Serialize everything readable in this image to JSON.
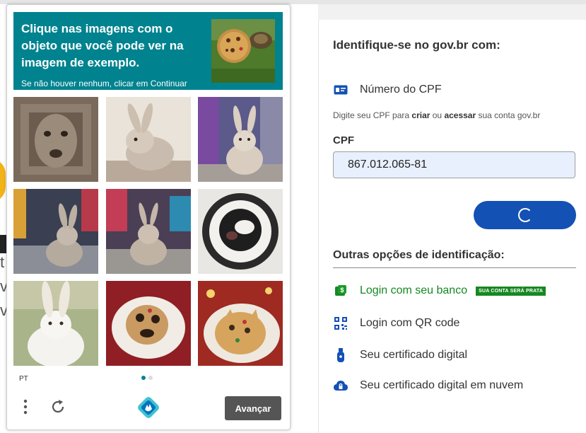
{
  "captcha": {
    "prompt": "Clique nas imagens com o objeto que você pode ver na imagem de exemplo.",
    "prompt_sub": "Se não houver nenhum, clicar em Continuar",
    "example_image": "cookie-and-turtle-image",
    "tiles": [
      {
        "subject": "distorted-animal-face"
      },
      {
        "subject": "rabbit"
      },
      {
        "subject": "rabbit"
      },
      {
        "subject": "rabbit-city-street"
      },
      {
        "subject": "rabbit-city-street"
      },
      {
        "subject": "distorted-plate"
      },
      {
        "subject": "white-rabbit"
      },
      {
        "subject": "cookie-on-plate"
      },
      {
        "subject": "cookie-on-plate"
      }
    ],
    "language": "PT",
    "page_dots": 2,
    "active_dot": 0,
    "submit_label": "Avançar",
    "accent_color": "#00838f"
  },
  "gov": {
    "title": "Identifique-se no gov.br com:",
    "cpf_option": "Número do CPF",
    "helper_pre": "Digite seu CPF para ",
    "helper_b1": "criar",
    "helper_mid": " ou ",
    "helper_b2": "acessar",
    "helper_post": " sua conta gov.br",
    "cpf_label": "CPF",
    "cpf_value": "867.012.065-81",
    "other_title": "Outras opções de identificação:",
    "options": [
      {
        "label": "Login com seu banco",
        "badge": "SUA CONTA SERÁ PRATA"
      },
      {
        "label": "Login com QR code"
      },
      {
        "label": "Seu certificado digital"
      },
      {
        "label": "Seu certificado digital em nuvem"
      }
    ],
    "brand_color": "#1351b4",
    "bank_color": "#168821"
  },
  "background": {
    "fragments": [
      "t",
      "v",
      "v"
    ]
  }
}
